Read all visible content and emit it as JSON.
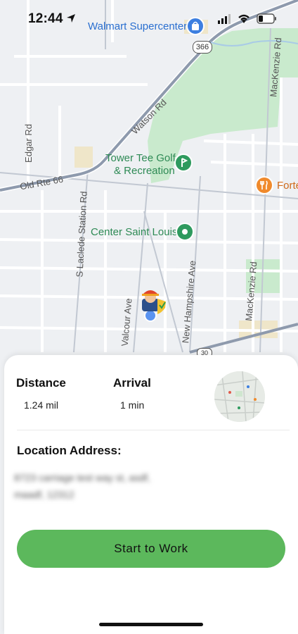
{
  "status_bar": {
    "time": "12:44"
  },
  "map": {
    "labels": {
      "walmart": "Walmart Supercenter",
      "route_366": "366",
      "watson_rd": "Watson Rd",
      "edgar_rd": "Edgar Rd",
      "old_rte_66": "Old Rte 66",
      "tower_tee_line1": "Tower Tee Golf",
      "tower_tee_line2": "& Recreation",
      "forte": "Forte",
      "s_laclede": "S Laclede Station Rd",
      "center_st_louis": "Center Saint Louis",
      "mackenzie_rd_top": "MacKenzie Rd",
      "mackenzie_rd_bottom": "MacKenzie Rd",
      "valcour_ave": "Valcour Ave",
      "new_hampshire_ave": "New Hampshire Ave",
      "route_30": "30"
    },
    "colors": {
      "park": "#c9eacd",
      "road": "#ffffff",
      "major_road": "#8e9aad",
      "land": "#eef0f3"
    }
  },
  "sheet": {
    "distance_label": "Distance",
    "distance_value": "1.24 mil",
    "arrival_label": "Arrival",
    "arrival_value": "1 min",
    "location_label": "Location Address:",
    "address_line1": "8723 carriage test way st, asdf,",
    "address_line2": "maadf, 12312",
    "button_label": "Start to Work",
    "button_color": "#5cb85c"
  }
}
